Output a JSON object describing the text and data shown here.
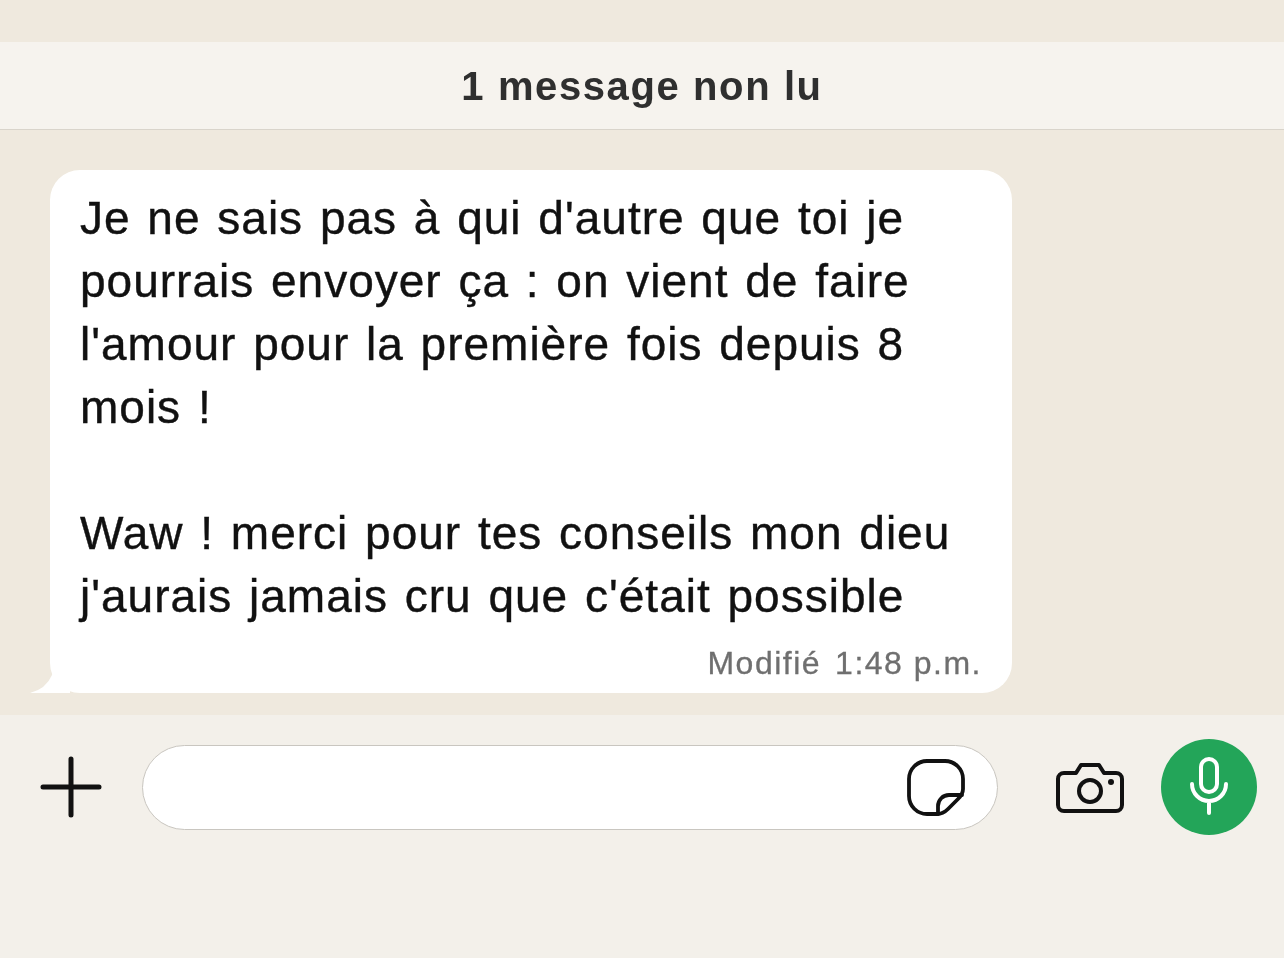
{
  "banner": {
    "text": "1 message non lu"
  },
  "messages": [
    {
      "paragraphs": [
        "Je ne sais pas à qui d'autre que toi je pourrais envoyer ça : on vient de faire l'amour pour la première fois depuis 8 mois !",
        "Waw ! merci pour tes conseils mon dieu j'aurais jamais cru que c'était possible"
      ],
      "edited_label": "Modifié",
      "time": "1:48 p.m."
    }
  ]
}
